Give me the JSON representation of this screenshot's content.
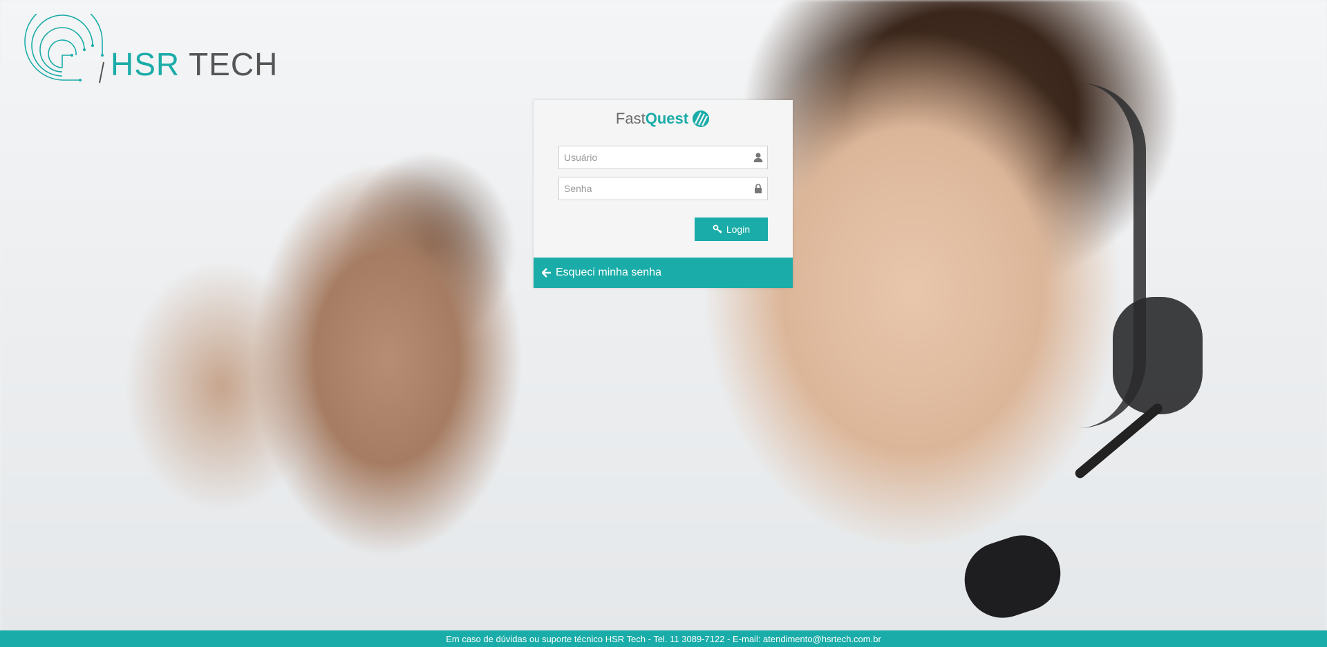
{
  "brand": {
    "company_logo_hsr": "HSR",
    "company_logo_tech": " TECH",
    "product_fast": "Fast",
    "product_quest": "Quest",
    "accent_color": "#1aaca8"
  },
  "login_form": {
    "username_placeholder": "Usuário",
    "password_placeholder": "Senha",
    "login_label": "Login",
    "forgot_label": "Esqueci minha senha"
  },
  "icons": {
    "username": "user-icon",
    "password": "lock-icon",
    "login": "key-icon",
    "forgot": "arrow-left-icon"
  },
  "footer": {
    "text": "Em caso de dúvidas ou suporte técnico HSR Tech - Tel. 11 3089-7122 - E-mail: atendimento@hsrtech.com.br"
  }
}
